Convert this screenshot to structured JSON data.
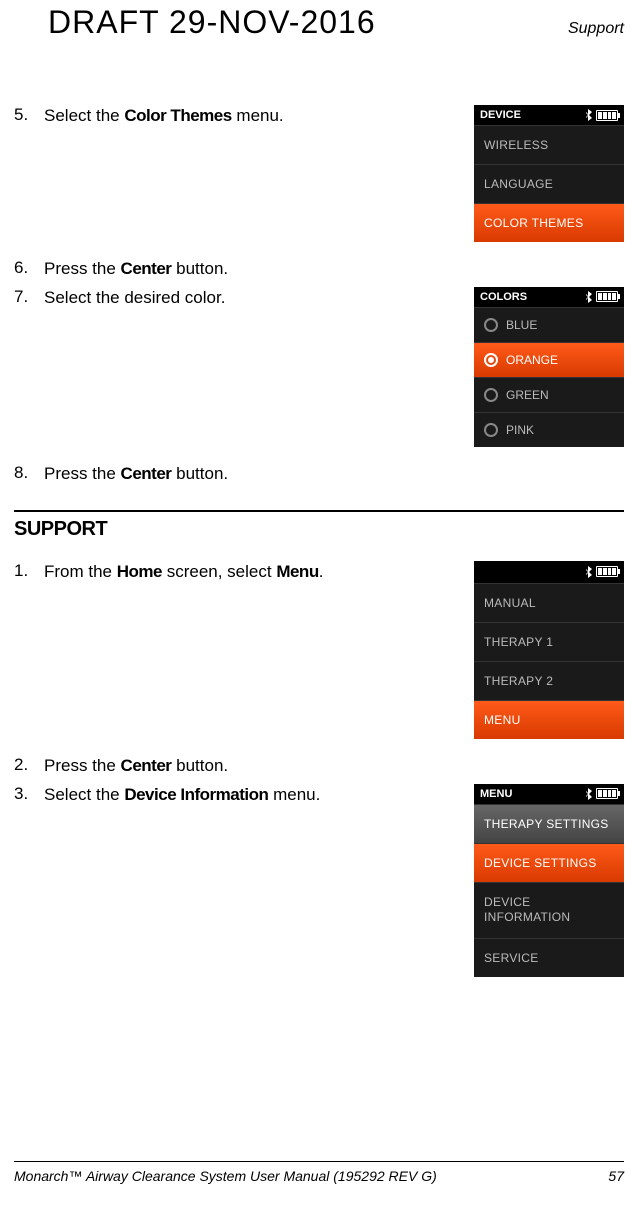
{
  "header": {
    "draft": "DRAFT  29-NOV-2016",
    "section": "Support"
  },
  "steps_a": [
    {
      "num": "5.",
      "pre": "Select the ",
      "bold": "Color Themes",
      "post": " menu."
    },
    {
      "num": "6.",
      "pre": "Press the ",
      "bold": "Center",
      "post": " button."
    },
    {
      "num": "7.",
      "pre": "Select the desired color.",
      "bold": "",
      "post": ""
    },
    {
      "num": "8.",
      "pre": "Press the ",
      "bold": "Center",
      "post": " button."
    }
  ],
  "support_heading": "SUPPORT",
  "steps_b": [
    {
      "num": "1.",
      "pre": "From the ",
      "bold": "Home",
      "post": " screen, select ",
      "bold2": "Menu",
      "post2": "."
    },
    {
      "num": "2.",
      "pre": "Press the ",
      "bold": "Center",
      "post": " button."
    },
    {
      "num": "3.",
      "pre": "Select the ",
      "bold": "Device Information",
      "post": " menu."
    }
  ],
  "screen_device": {
    "title": "DEVICE",
    "items": [
      "WIRELESS",
      "LANGUAGE",
      "COLOR THEMES"
    ]
  },
  "screen_colors": {
    "title": "COLORS",
    "items": [
      "BLUE",
      "ORANGE",
      "GREEN",
      "PINK"
    ]
  },
  "screen_home": {
    "items": [
      "MANUAL",
      "THERAPY 1",
      "THERAPY 2",
      "MENU"
    ]
  },
  "screen_menu": {
    "title": "MENU",
    "items": [
      "THERAPY SETTINGS",
      "DEVICE SETTINGS",
      "DEVICE INFORMATION",
      "SERVICE"
    ]
  },
  "footer": {
    "left": "Monarch™ Airway Clearance System User Manual (195292 REV G)",
    "right": "57"
  }
}
